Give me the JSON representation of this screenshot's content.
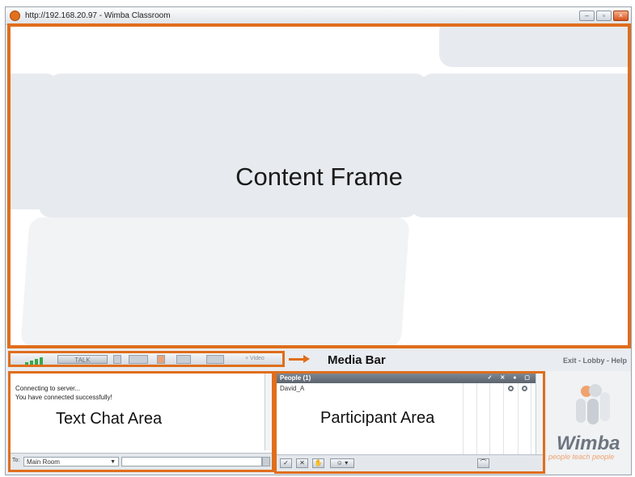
{
  "window": {
    "title": "http://192.168.20.97 - Wimba Classroom",
    "controls": {
      "minimize": "–",
      "restore": "▫",
      "close": "×"
    }
  },
  "content_frame": {
    "label": "Content Frame"
  },
  "media_bar": {
    "talk_label": "TALK",
    "label": "Media Bar",
    "extra": "+ Video"
  },
  "top_links": "Exit - Lobby - Help",
  "text_chat": {
    "label": "Text Chat Area",
    "messages": [
      "Connecting to server...",
      "You have connected successfully!"
    ],
    "to_label": "To:",
    "room": "Main Room"
  },
  "participant": {
    "label": "Participant Area",
    "header": "People (1)",
    "rows": [
      "David_A"
    ]
  },
  "wimba": {
    "logo": "Wimba",
    "tagline": "people teach people"
  },
  "colors": {
    "accent": "#e06e1c"
  },
  "icons": [
    "app-icon",
    "signal-icon",
    "gear-icon",
    "arrow-icon",
    "checkmark-icon",
    "x-icon"
  ]
}
